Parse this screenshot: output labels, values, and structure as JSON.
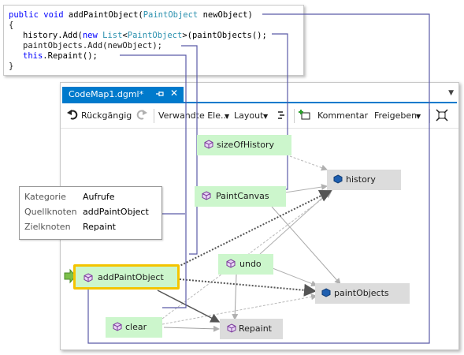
{
  "code": {
    "line1": {
      "kw1": "public",
      "kw2": "void",
      "method": "addPaintObject(",
      "type": "PaintObject",
      "param": "newObject)"
    },
    "line2": "{",
    "line3": {
      "pre": "history.Add(",
      "kw": "new",
      "type1": "List",
      "lt": "<",
      "type2": "PaintObject",
      "post": ">(paintObjects();"
    },
    "line4": "paintObjects.Add(newObject);",
    "line5": {
      "kw": "this",
      "post": ".Repaint();"
    },
    "line6": "}"
  },
  "window": {
    "tab_title": "CodeMap1.dgml*",
    "pin_glyph": "ᵖ",
    "close_glyph": "✕",
    "dropdown_glyph": "▼"
  },
  "toolbar": {
    "undo_label": "Rückgängig",
    "related_label": "Verwandte Ele...",
    "layout_label": "Layout",
    "comment_label": "Kommentar",
    "share_label": "Freigeben"
  },
  "nodes": {
    "sizeOfHistory": "sizeOfHistory",
    "history": "history",
    "paintCanvas": "PaintCanvas",
    "undo": "undo",
    "addPaintObject": "addPaintObject",
    "paintObjects": "paintObjects",
    "clear": "clear",
    "repaint": "Repaint"
  },
  "tooltip": {
    "rows": [
      {
        "key": "Kategorie",
        "value": "Aufrufe"
      },
      {
        "key": "Quellknoten",
        "value": "addPaintObject"
      },
      {
        "key": "Zielknoten",
        "value": "Repaint"
      }
    ]
  },
  "colors": {
    "accent": "#007acc",
    "member_node": "#ccf6cc",
    "type_node": "#dcdcdc",
    "selection": "#f4c400",
    "connector": "#5a5aa8"
  },
  "icons": {
    "undo": "undo-icon",
    "redo": "redo-icon",
    "layout": "layout-icon",
    "comment": "comment-icon",
    "share": "share-icon",
    "fit": "fit-to-window-icon",
    "method": "method-cube-icon",
    "field": "field-cube-icon",
    "class": "class-icon"
  }
}
